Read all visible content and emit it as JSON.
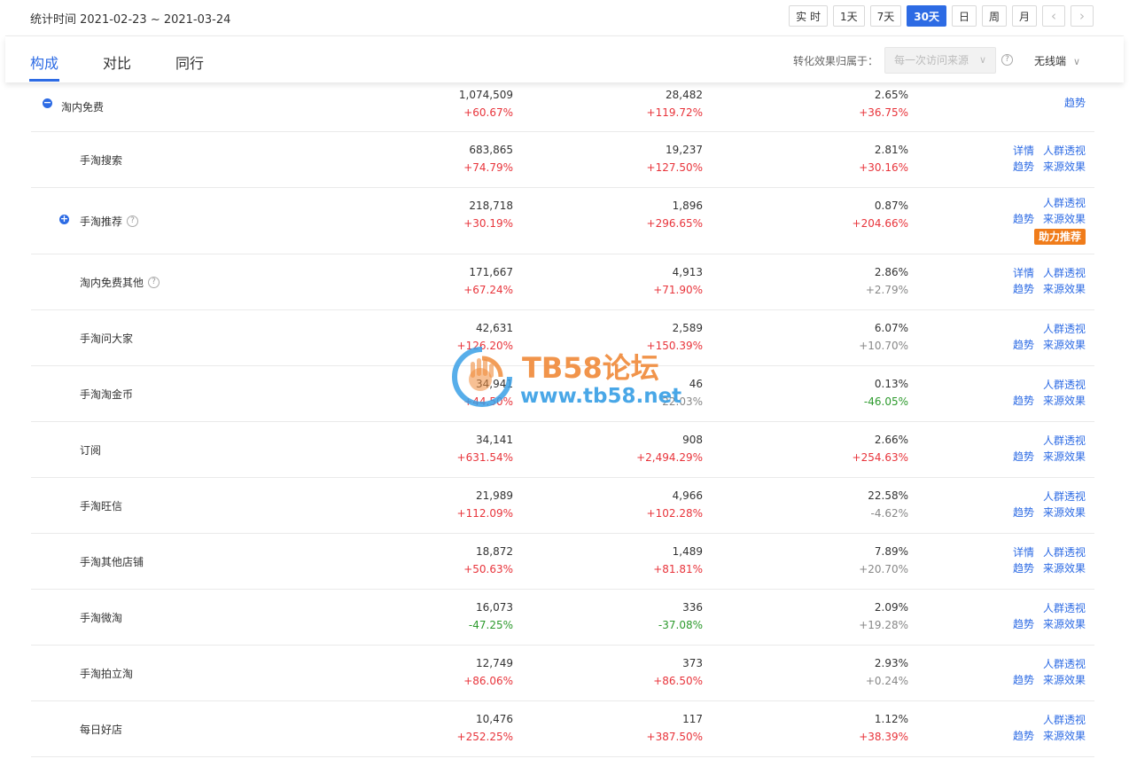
{
  "header": {
    "date_range": "统计时间 2021-02-23 ~ 2021-03-24",
    "period_buttons": [
      "实 时",
      "1天",
      "7天",
      "30天",
      "日",
      "周",
      "月"
    ],
    "active_period": "30天",
    "prev_arrow": "‹",
    "next_arrow": "›"
  },
  "tabs": {
    "items": [
      "构成",
      "对比",
      "同行"
    ],
    "active": "构成",
    "attribution_label": "转化效果归属于：",
    "attribution_value": "每一次访问来源",
    "help_glyph": "?",
    "device_value": "无线端"
  },
  "rows": [
    {
      "name": "淘内免费",
      "toggle": "−",
      "v1": "1,074,509",
      "c1": "+60.67%",
      "v2": "28,482",
      "c2": "+119.72%",
      "v3": "2.65%",
      "c3": "+36.75%",
      "links_top": [],
      "links_bottom": [
        "趋势"
      ]
    },
    {
      "name": "手淘搜索",
      "v1": "683,865",
      "c1": "+74.79%",
      "v2": "19,237",
      "c2": "+127.50%",
      "v3": "2.81%",
      "c3": "+30.16%",
      "links_top": [
        "详情",
        "人群透视"
      ],
      "links_bottom": [
        "趋势",
        "来源效果"
      ]
    },
    {
      "name": "手淘推荐",
      "toggle": "+",
      "help": true,
      "v1": "218,718",
      "c1": "+30.19%",
      "v2": "1,896",
      "c2": "+296.65%",
      "v3": "0.87%",
      "c3": "+204.66%",
      "links_top": [
        "人群透视"
      ],
      "links_bottom": [
        "趋势",
        "来源效果"
      ],
      "badge": "助力推荐"
    },
    {
      "name": "淘内免费其他",
      "help": true,
      "v1": "171,667",
      "c1": "+67.24%",
      "v2": "4,913",
      "c2": "+71.90%",
      "v3": "2.86%",
      "c3": "+2.79%",
      "c3_tone": "neutral",
      "links_top": [
        "详情",
        "人群透视"
      ],
      "links_bottom": [
        "趋势",
        "来源效果"
      ]
    },
    {
      "name": "手淘问大家",
      "v1": "42,631",
      "c1": "+126.20%",
      "v2": "2,589",
      "c2": "+150.39%",
      "v3": "6.07%",
      "c3": "+10.70%",
      "c3_tone": "neutral",
      "links_top": [
        "人群透视"
      ],
      "links_bottom": [
        "趋势",
        "来源效果"
      ]
    },
    {
      "name": "手淘淘金币",
      "v1": "34,941",
      "c1": "+44.50%",
      "v2": "46",
      "c2": "22.03%",
      "c2_tone": "neutral",
      "v3": "0.13%",
      "c3": "-46.05%",
      "c3_tone": "down",
      "links_top": [
        "人群透视"
      ],
      "links_bottom": [
        "趋势",
        "来源效果"
      ]
    },
    {
      "name": "订阅",
      "v1": "34,141",
      "c1": "+631.54%",
      "v2": "908",
      "c2": "+2,494.29%",
      "v3": "2.66%",
      "c3": "+254.63%",
      "links_top": [
        "人群透视"
      ],
      "links_bottom": [
        "趋势",
        "来源效果"
      ]
    },
    {
      "name": "手淘旺信",
      "v1": "21,989",
      "c1": "+112.09%",
      "v2": "4,966",
      "c2": "+102.28%",
      "v3": "22.58%",
      "c3": "-4.62%",
      "c3_tone": "neutral",
      "links_top": [
        "人群透视"
      ],
      "links_bottom": [
        "趋势",
        "来源效果"
      ]
    },
    {
      "name": "手淘其他店铺",
      "v1": "18,872",
      "c1": "+50.63%",
      "v2": "1,489",
      "c2": "+81.81%",
      "v3": "7.89%",
      "c3": "+20.70%",
      "c3_tone": "neutral",
      "links_top": [
        "详情",
        "人群透视"
      ],
      "links_bottom": [
        "趋势",
        "来源效果"
      ]
    },
    {
      "name": "手淘微淘",
      "v1": "16,073",
      "c1": "-47.25%",
      "c1_tone": "down",
      "v2": "336",
      "c2": "-37.08%",
      "c2_tone": "down",
      "v3": "2.09%",
      "c3": "+19.28%",
      "c3_tone": "neutral",
      "links_top": [
        "人群透视"
      ],
      "links_bottom": [
        "趋势",
        "来源效果"
      ]
    },
    {
      "name": "手淘拍立淘",
      "v1": "12,749",
      "c1": "+86.06%",
      "v2": "373",
      "c2": "+86.50%",
      "v3": "2.93%",
      "c3": "+0.24%",
      "c3_tone": "neutral",
      "links_top": [
        "人群透视"
      ],
      "links_bottom": [
        "趋势",
        "来源效果"
      ]
    },
    {
      "name": "每日好店",
      "v1": "10,476",
      "c1": "+252.25%",
      "v2": "117",
      "c2": "+387.50%",
      "v3": "1.12%",
      "c3": "+38.39%",
      "links_top": [
        "人群透视"
      ],
      "links_bottom": [
        "趋势",
        "来源效果"
      ]
    }
  ],
  "watermark": {
    "title": "TB58论坛",
    "url": "www.tb58.net"
  },
  "colors": {
    "accent": "#2d6be4",
    "increase": "#e8343b",
    "decrease": "#2d9a2d",
    "badge": "#f07c1a"
  }
}
